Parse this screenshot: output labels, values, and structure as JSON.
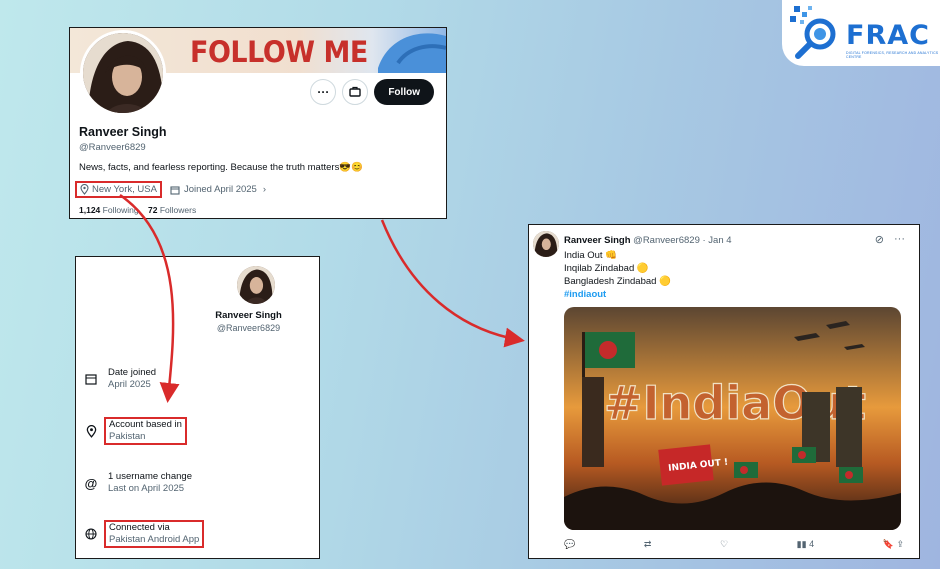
{
  "logo": {
    "name": "FRAC",
    "subtitle": "DIGITAL FORENSICS, RESEARCH AND ANALYTICS CENTRE"
  },
  "profile": {
    "banner_text": "FOLLOW ME",
    "name": "Ranveer Singh",
    "handle": "@Ranveer6829",
    "bio": "News, facts, and fearless reporting. Because the truth matters😎😊",
    "location": "New York, USA",
    "joined": "Joined April 2025",
    "following_count": "1,124",
    "following_label": "Following",
    "followers_count": "72",
    "followers_label": "Followers",
    "follow_label": "Follow",
    "more_icon": "ellipsis-icon",
    "message_icon": "message-icon"
  },
  "about": {
    "name": "Ranveer Singh",
    "handle": "@Ranveer6829",
    "date_joined_label": "Date joined",
    "date_joined_value": "April 2025",
    "account_based_label": "Account based in",
    "account_based_value": "Pakistan",
    "username_change_label": "1 username change",
    "username_change_value": "Last on April 2025",
    "connected_label": "Connected via",
    "connected_value": "Pakistan Android App"
  },
  "tweet": {
    "name": "Ranveer Singh",
    "meta": "@Ranveer6829 · Jan 4",
    "line1": "India Out 👊",
    "line2": "Inqilab Zindabad 🟡",
    "line3": "Bangladesh Zindabad 🟡",
    "hashtag": "#indiaout",
    "image_text": "#IndiaOut",
    "placard_text": "INDIA OUT !",
    "views": "4"
  },
  "colors": {
    "highlight": "#d92b2b",
    "link": "#1d9bf0",
    "brand": "#1d6fd1"
  }
}
